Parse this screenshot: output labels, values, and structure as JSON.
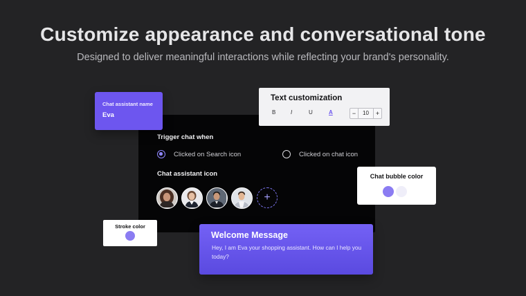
{
  "hero": {
    "title": "Customize appearance and conversational tone",
    "subtitle": "Designed to deliver meaningful interactions while reflecting your brand's personality."
  },
  "assistant_name_card": {
    "label": "Chat assistant name",
    "value": "Eva"
  },
  "text_customization": {
    "title": "Text customization",
    "bold": "B",
    "italic": "I",
    "underline": "U",
    "color": "A",
    "minus": "−",
    "font_size": "10",
    "plus": "+"
  },
  "trigger": {
    "title": "Trigger chat  when",
    "options": [
      {
        "label": "Clicked on Search icon",
        "selected": true
      },
      {
        "label": "Clicked on chat icon",
        "selected": false
      }
    ]
  },
  "assistant_icon": {
    "title": "Chat assistant icon",
    "add_label": "+"
  },
  "bubble_color": {
    "title": "Chat bubble color",
    "swatches": [
      "#8b7cf2",
      "#efeef9"
    ]
  },
  "stroke_color": {
    "title": "Stroke color",
    "swatch": "#8b7cf2"
  },
  "welcome": {
    "title": "Welcome Message",
    "message": "Hey, I am Eva your shopping assistant. How can I help you today?"
  },
  "colors": {
    "accent": "#6d56ef",
    "background": "#232325"
  }
}
